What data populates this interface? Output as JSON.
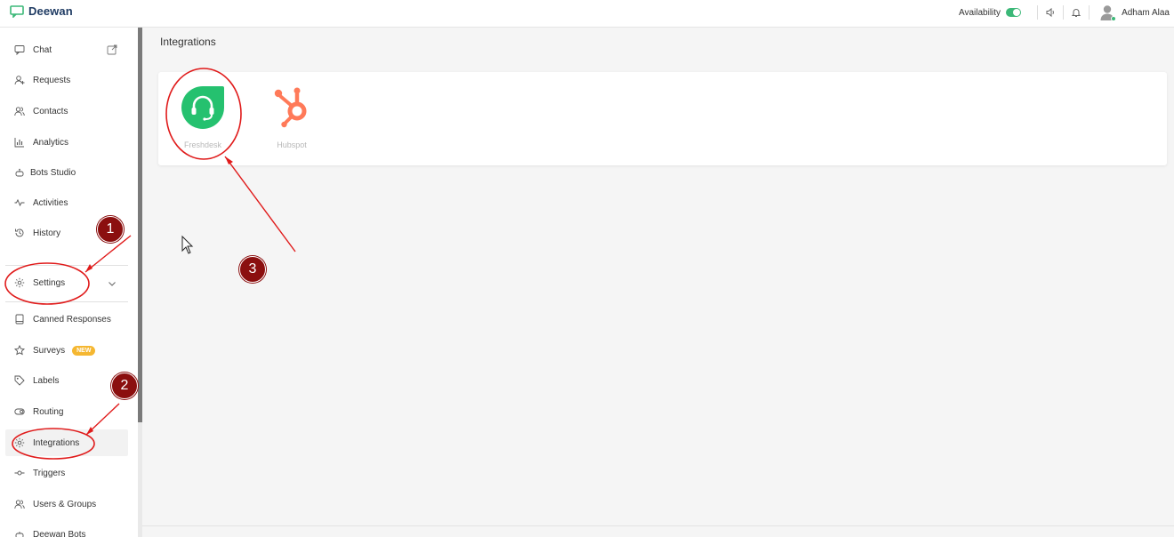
{
  "app": {
    "name": "Deewan"
  },
  "header": {
    "availability_label": "Availability",
    "availability_on": true,
    "user_name": "Adham Alaa",
    "icons": [
      "speaker-icon",
      "bell-icon",
      "user-avatar-icon"
    ]
  },
  "sidebar": {
    "items": [
      {
        "label": "Chat",
        "icon": "chat-icon"
      },
      {
        "label": "Requests",
        "icon": "user-plus-icon"
      },
      {
        "label": "Contacts",
        "icon": "contacts-icon"
      },
      {
        "label": "Analytics",
        "icon": "bar-chart-icon"
      },
      {
        "label": "Bots Studio",
        "icon": "bot-icon"
      },
      {
        "label": "Activities",
        "icon": "activity-icon"
      },
      {
        "label": "History",
        "icon": "history-icon"
      }
    ],
    "settings_label": "Settings",
    "settings_items": [
      {
        "label": "Canned Responses",
        "icon": "book-icon"
      },
      {
        "label": "Surveys",
        "icon": "star-icon",
        "badge": "NEW"
      },
      {
        "label": "Labels",
        "icon": "tag-icon"
      },
      {
        "label": "Routing",
        "icon": "routing-icon"
      },
      {
        "label": "Integrations",
        "icon": "gear-icon",
        "active": true
      },
      {
        "label": "Triggers",
        "icon": "trigger-icon"
      },
      {
        "label": "Users & Groups",
        "icon": "users-icon"
      },
      {
        "label": "Deewan Bots",
        "icon": "bot-icon"
      }
    ]
  },
  "main": {
    "title": "Integrations",
    "integrations": [
      {
        "name": "Freshdesk",
        "brand_color": "#25c16f"
      },
      {
        "name": "Hubspot",
        "brand_color": "#ff7a59"
      }
    ]
  },
  "annotations": {
    "steps": [
      "1",
      "2",
      "3"
    ],
    "color": "#e01b1b",
    "badge_color": "#8b0f0f"
  },
  "colors": {
    "accent_green": "#3cb878",
    "badge_yellow": "#f5b731",
    "logo_navy": "#1f3b63"
  }
}
